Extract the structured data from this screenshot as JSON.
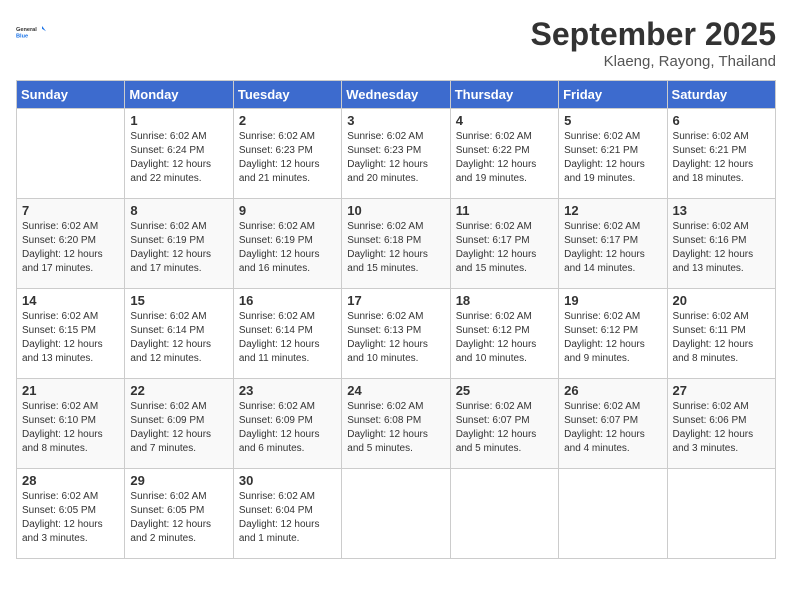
{
  "header": {
    "logo_general": "General",
    "logo_blue": "Blue",
    "month": "September 2025",
    "location": "Klaeng, Rayong, Thailand"
  },
  "weekdays": [
    "Sunday",
    "Monday",
    "Tuesday",
    "Wednesday",
    "Thursday",
    "Friday",
    "Saturday"
  ],
  "weeks": [
    [
      {
        "num": "",
        "info": ""
      },
      {
        "num": "1",
        "info": "Sunrise: 6:02 AM\nSunset: 6:24 PM\nDaylight: 12 hours\nand 22 minutes."
      },
      {
        "num": "2",
        "info": "Sunrise: 6:02 AM\nSunset: 6:23 PM\nDaylight: 12 hours\nand 21 minutes."
      },
      {
        "num": "3",
        "info": "Sunrise: 6:02 AM\nSunset: 6:23 PM\nDaylight: 12 hours\nand 20 minutes."
      },
      {
        "num": "4",
        "info": "Sunrise: 6:02 AM\nSunset: 6:22 PM\nDaylight: 12 hours\nand 19 minutes."
      },
      {
        "num": "5",
        "info": "Sunrise: 6:02 AM\nSunset: 6:21 PM\nDaylight: 12 hours\nand 19 minutes."
      },
      {
        "num": "6",
        "info": "Sunrise: 6:02 AM\nSunset: 6:21 PM\nDaylight: 12 hours\nand 18 minutes."
      }
    ],
    [
      {
        "num": "7",
        "info": "Sunrise: 6:02 AM\nSunset: 6:20 PM\nDaylight: 12 hours\nand 17 minutes."
      },
      {
        "num": "8",
        "info": "Sunrise: 6:02 AM\nSunset: 6:19 PM\nDaylight: 12 hours\nand 17 minutes."
      },
      {
        "num": "9",
        "info": "Sunrise: 6:02 AM\nSunset: 6:19 PM\nDaylight: 12 hours\nand 16 minutes."
      },
      {
        "num": "10",
        "info": "Sunrise: 6:02 AM\nSunset: 6:18 PM\nDaylight: 12 hours\nand 15 minutes."
      },
      {
        "num": "11",
        "info": "Sunrise: 6:02 AM\nSunset: 6:17 PM\nDaylight: 12 hours\nand 15 minutes."
      },
      {
        "num": "12",
        "info": "Sunrise: 6:02 AM\nSunset: 6:17 PM\nDaylight: 12 hours\nand 14 minutes."
      },
      {
        "num": "13",
        "info": "Sunrise: 6:02 AM\nSunset: 6:16 PM\nDaylight: 12 hours\nand 13 minutes."
      }
    ],
    [
      {
        "num": "14",
        "info": "Sunrise: 6:02 AM\nSunset: 6:15 PM\nDaylight: 12 hours\nand 13 minutes."
      },
      {
        "num": "15",
        "info": "Sunrise: 6:02 AM\nSunset: 6:14 PM\nDaylight: 12 hours\nand 12 minutes."
      },
      {
        "num": "16",
        "info": "Sunrise: 6:02 AM\nSunset: 6:14 PM\nDaylight: 12 hours\nand 11 minutes."
      },
      {
        "num": "17",
        "info": "Sunrise: 6:02 AM\nSunset: 6:13 PM\nDaylight: 12 hours\nand 10 minutes."
      },
      {
        "num": "18",
        "info": "Sunrise: 6:02 AM\nSunset: 6:12 PM\nDaylight: 12 hours\nand 10 minutes."
      },
      {
        "num": "19",
        "info": "Sunrise: 6:02 AM\nSunset: 6:12 PM\nDaylight: 12 hours\nand 9 minutes."
      },
      {
        "num": "20",
        "info": "Sunrise: 6:02 AM\nSunset: 6:11 PM\nDaylight: 12 hours\nand 8 minutes."
      }
    ],
    [
      {
        "num": "21",
        "info": "Sunrise: 6:02 AM\nSunset: 6:10 PM\nDaylight: 12 hours\nand 8 minutes."
      },
      {
        "num": "22",
        "info": "Sunrise: 6:02 AM\nSunset: 6:09 PM\nDaylight: 12 hours\nand 7 minutes."
      },
      {
        "num": "23",
        "info": "Sunrise: 6:02 AM\nSunset: 6:09 PM\nDaylight: 12 hours\nand 6 minutes."
      },
      {
        "num": "24",
        "info": "Sunrise: 6:02 AM\nSunset: 6:08 PM\nDaylight: 12 hours\nand 5 minutes."
      },
      {
        "num": "25",
        "info": "Sunrise: 6:02 AM\nSunset: 6:07 PM\nDaylight: 12 hours\nand 5 minutes."
      },
      {
        "num": "26",
        "info": "Sunrise: 6:02 AM\nSunset: 6:07 PM\nDaylight: 12 hours\nand 4 minutes."
      },
      {
        "num": "27",
        "info": "Sunrise: 6:02 AM\nSunset: 6:06 PM\nDaylight: 12 hours\nand 3 minutes."
      }
    ],
    [
      {
        "num": "28",
        "info": "Sunrise: 6:02 AM\nSunset: 6:05 PM\nDaylight: 12 hours\nand 3 minutes."
      },
      {
        "num": "29",
        "info": "Sunrise: 6:02 AM\nSunset: 6:05 PM\nDaylight: 12 hours\nand 2 minutes."
      },
      {
        "num": "30",
        "info": "Sunrise: 6:02 AM\nSunset: 6:04 PM\nDaylight: 12 hours\nand 1 minute."
      },
      {
        "num": "",
        "info": ""
      },
      {
        "num": "",
        "info": ""
      },
      {
        "num": "",
        "info": ""
      },
      {
        "num": "",
        "info": ""
      }
    ]
  ]
}
